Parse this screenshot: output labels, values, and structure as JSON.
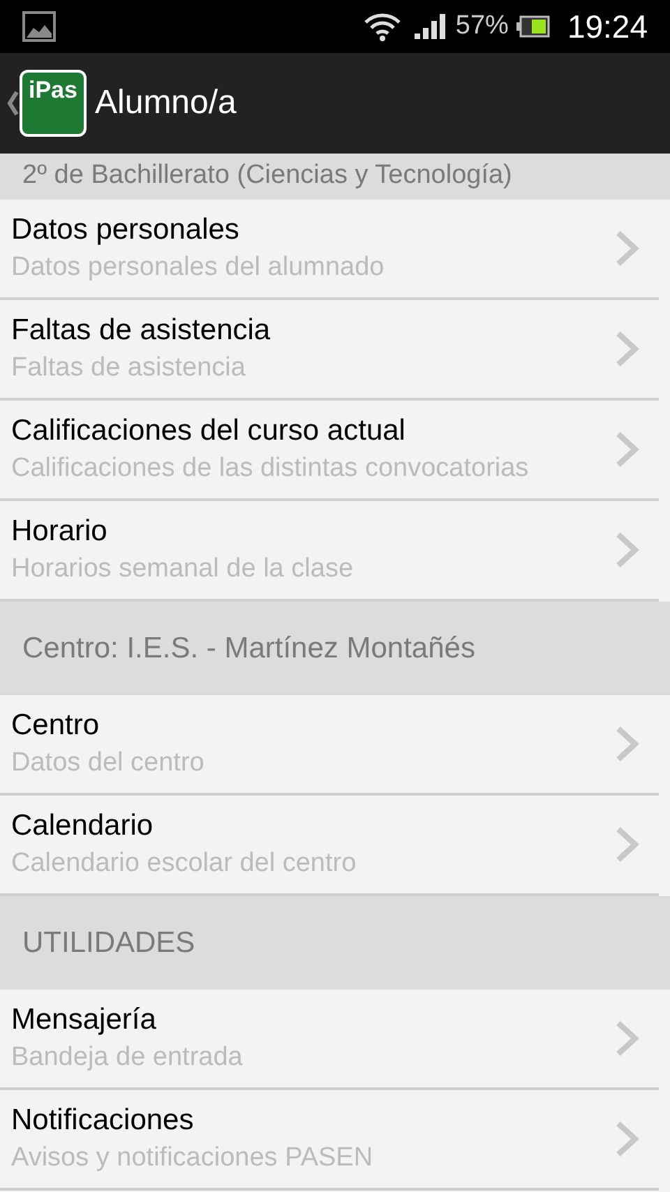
{
  "status_bar": {
    "battery": "57%",
    "time": "19:24"
  },
  "action_bar": {
    "logo": "iPas",
    "title": "Alumno/a"
  },
  "sections": [
    {
      "header": "2º de Bachillerato (Ciencias y Tecnología)",
      "items": [
        {
          "title": "Datos personales",
          "subtitle": "Datos personales del alumnado"
        },
        {
          "title": "Faltas de asistencia",
          "subtitle": "Faltas de asistencia"
        },
        {
          "title": "Calificaciones del curso actual",
          "subtitle": "Calificaciones de las distintas convocatorias"
        },
        {
          "title": "Horario",
          "subtitle": "Horarios semanal de la clase"
        }
      ]
    },
    {
      "header": "Centro: I.E.S. - Martínez Montañés",
      "items": [
        {
          "title": "Centro",
          "subtitle": "Datos del centro"
        },
        {
          "title": "Calendario",
          "subtitle": "Calendario escolar del centro"
        }
      ]
    },
    {
      "header": "UTILIDADES",
      "items": [
        {
          "title": "Mensajería",
          "subtitle": "Bandeja de entrada"
        },
        {
          "title": "Notificaciones",
          "subtitle": "Avisos y notificaciones PASEN"
        }
      ]
    }
  ]
}
